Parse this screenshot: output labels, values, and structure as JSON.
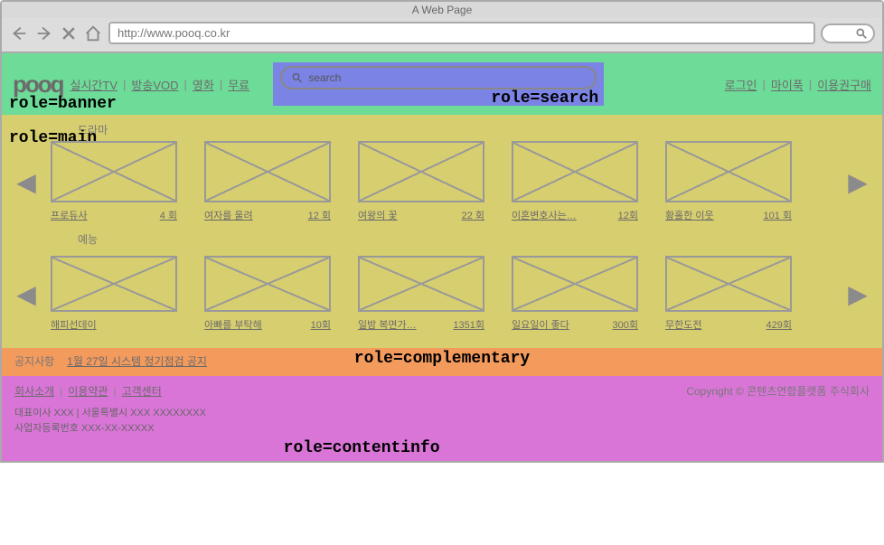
{
  "chrome": {
    "title": "A Web Page",
    "url": "http://www.pooq.co.kr"
  },
  "role_labels": {
    "banner": "role=banner",
    "search": "role=search",
    "main": "role=main",
    "complementary": "role=complementary",
    "contentinfo": "role=contentinfo"
  },
  "banner": {
    "logo": "pooq",
    "nav": [
      "실시간TV",
      "방송VOD",
      "영화",
      "무료"
    ],
    "search_placeholder": "search",
    "user": [
      "로그인",
      "마이푹",
      "이용권구매"
    ]
  },
  "main": {
    "sections": [
      {
        "title": "드라마",
        "items": [
          {
            "title": "프로듀사",
            "ep": "4 회"
          },
          {
            "title": "여자를 울려",
            "ep": "12 회"
          },
          {
            "title": "여왕의 꽃",
            "ep": "22 회"
          },
          {
            "title": "이혼변호사는…",
            "ep": "12회"
          },
          {
            "title": "황홀한 이웃",
            "ep": "101 회"
          }
        ]
      },
      {
        "title": "예능",
        "items": [
          {
            "title": "해피선데이",
            "ep": ""
          },
          {
            "title": "아빠를 부탁해",
            "ep": "10회"
          },
          {
            "title": "일밤 복면가…",
            "ep": "1351회"
          },
          {
            "title": "일요일이 좋다",
            "ep": "300회"
          },
          {
            "title": "무한도전",
            "ep": "429회"
          }
        ]
      }
    ]
  },
  "complementary": {
    "label": "공지사항",
    "notice": "1월 27일 시스템 정기점검 공지"
  },
  "contentinfo": {
    "links": [
      "회사소개",
      "이용약관",
      "고객센터"
    ],
    "copyright": "Copyright © 콘텐츠연합플랫폼 주식회사",
    "info1": "대표이사 XXX | 서울특별시 XXX XXXXXXXX",
    "info2": "사업자등록번호 XXX-XX-XXXXX"
  }
}
